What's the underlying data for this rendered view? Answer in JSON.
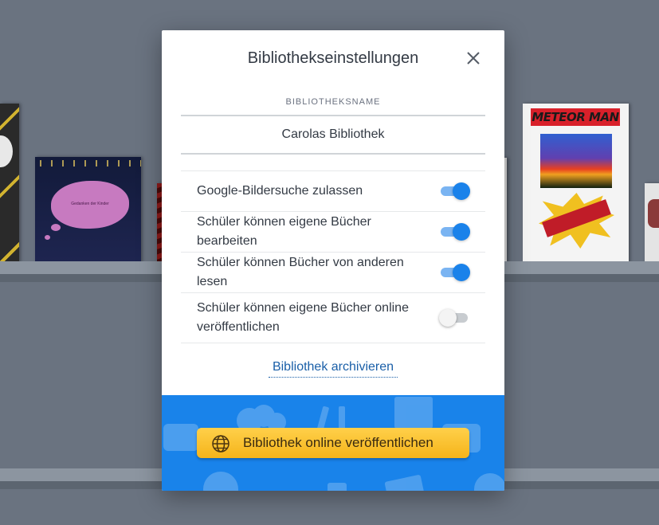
{
  "dialog": {
    "title": "Bibliothekseinstellungen",
    "close_icon": "close-icon"
  },
  "library_name": {
    "label": "BIBLIOTHEKSNAME",
    "value": "Carolas Bibliothek"
  },
  "settings": [
    {
      "label": "Google-Bildersuche zulassen",
      "enabled": true
    },
    {
      "label": "Schüler können eigene Bücher bearbeiten",
      "enabled": true
    },
    {
      "label": "Schüler können Bücher von anderen lesen",
      "enabled": true
    },
    {
      "label": "Schüler können eigene Bücher online veröffentlichen",
      "enabled": false
    }
  ],
  "archive_link": "Bibliothek archivieren",
  "publish": {
    "label": "Bibliothek online veröffentlichen",
    "icon": "globe-icon"
  },
  "background_books": {
    "book_b_caption": "Gedanken der Kinder",
    "book_e_title": "METEOR MAN"
  },
  "colors": {
    "accent": "#1a82ea",
    "banner": "#1983ea",
    "publish_button": "#f5b41a",
    "link": "#1a5fa8"
  }
}
